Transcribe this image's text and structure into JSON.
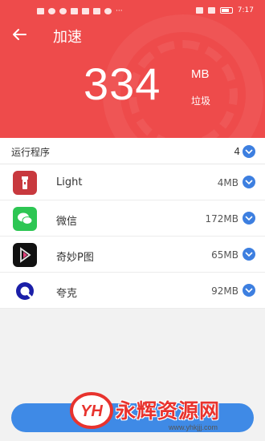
{
  "status_bar": {
    "time": "7:17"
  },
  "header": {
    "title": "加速",
    "junk_amount": "334",
    "junk_unit": "MB",
    "junk_label": "垃圾"
  },
  "list": {
    "header_label": "运行程序",
    "count": "4",
    "apps": [
      {
        "name": "Light",
        "size": "4MB",
        "icon": "flashlight-app-icon",
        "color": "#c8393e"
      },
      {
        "name": "微信",
        "size": "172MB",
        "icon": "wechat-app-icon",
        "color": "#2dc653"
      },
      {
        "name": "奇妙P图",
        "size": "65MB",
        "icon": "photo-editor-app-icon",
        "color": "#111111"
      },
      {
        "name": "夸克",
        "size": "92MB",
        "icon": "quark-browser-app-icon",
        "color": "#1b1fa8"
      }
    ]
  },
  "watermark": {
    "text": "永辉资源网",
    "url": "www.yhkjjj.com"
  },
  "colors": {
    "header_red": "#ee4b4b",
    "check_blue": "#3d7fe0",
    "button_blue": "#3f8ae6"
  }
}
